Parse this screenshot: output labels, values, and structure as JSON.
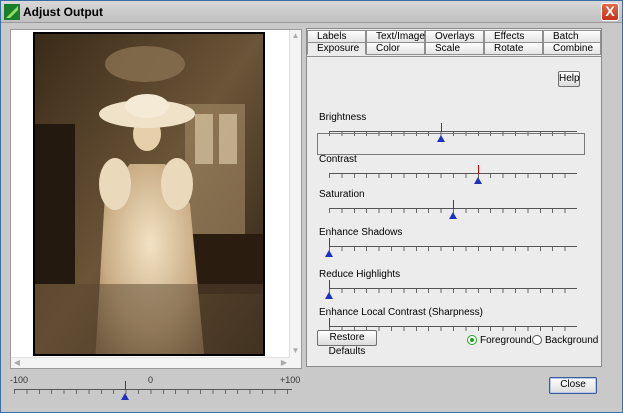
{
  "window": {
    "title": "Adjust Output",
    "close_glyph": "X",
    "icon": "app-leaf-icon"
  },
  "preview": {
    "scale": {
      "min_label": "-100",
      "mid_label": "0",
      "max_label": "+100",
      "value": -20
    }
  },
  "tabs": {
    "row1": [
      "Labels",
      "Text/Images",
      "Overlays",
      "Effects",
      "Batch"
    ],
    "row2": [
      "Exposure",
      "Color",
      "Scale",
      "Rotate",
      "Combine"
    ],
    "active": "Exposure"
  },
  "exposure": {
    "help_label": "Help",
    "sliders": [
      {
        "label": "Brightness",
        "value": 0.45
      },
      {
        "label": "Contrast",
        "value": 0.6
      },
      {
        "label": "Saturation",
        "value": 0.5
      },
      {
        "label": "Enhance Shadows",
        "value": 0.0
      },
      {
        "label": "Reduce Highlights",
        "value": 0.0
      },
      {
        "label": "Enhance Local Contrast (Sharpness)",
        "value": 0.0
      }
    ],
    "restore_label": "Restore Defaults",
    "radio_foreground": "Foreground",
    "radio_background": "Background",
    "selected": "Foreground"
  },
  "footer": {
    "close_label": "Close"
  },
  "colors": {
    "accent": "#1f2fbf",
    "marker": "#e00000",
    "radio_on": "#1ea41e"
  }
}
